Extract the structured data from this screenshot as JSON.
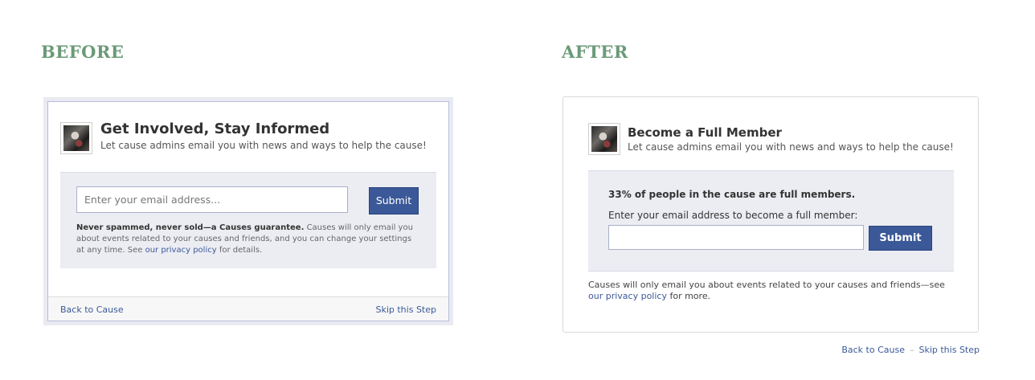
{
  "labels": {
    "before": "BEFORE",
    "after": "AFTER"
  },
  "before": {
    "title": "Get Involved, Stay Informed",
    "subtitle": "Let cause admins email you with news and ways to help the cause!",
    "email_placeholder": "Enter your email address...",
    "submit_label": "Submit",
    "note_bold": "Never spammed, never sold—a Causes guarantee.",
    "note_text": " Causes will only email you about events related to your causes and friends, and you can change your settings at any time. See ",
    "note_link": "our privacy policy",
    "note_tail": " for details.",
    "back_link": "Back to Cause",
    "skip_link": "Skip this Step"
  },
  "after": {
    "title": "Become a Full Member",
    "subtitle": "Let cause admins email you with news and ways to help the cause!",
    "stat": "33% of people in the cause are full members.",
    "prompt": "Enter your email address to become a full member:",
    "email_value": "",
    "submit_label": "Submit",
    "note_text": "Causes will only email you about events related to your causes and friends—see ",
    "note_link": "our privacy policy",
    "note_tail": " for more.",
    "back_link": "Back to Cause",
    "separator": "–",
    "skip_link": "Skip this Step"
  },
  "colors": {
    "label_green": "#6b9a78",
    "facebook_blue": "#3b5998",
    "panel_gray": "#ecedf3"
  }
}
